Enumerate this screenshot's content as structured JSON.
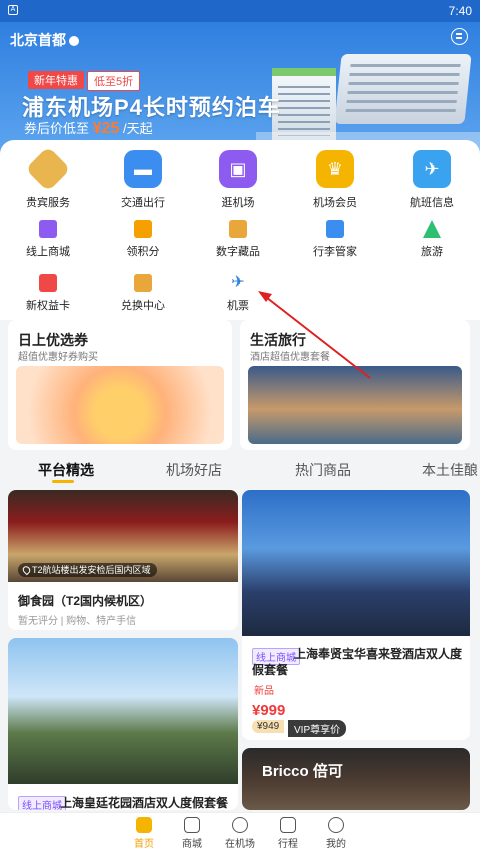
{
  "status": {
    "time": "7:40"
  },
  "header": {
    "city": "北京首都"
  },
  "hero": {
    "tag_new": "新年特惠",
    "tag_discount": "低至5折",
    "title": "浦东机场P4长时预约泊车",
    "sub_prefix": "券后价低至",
    "price": "¥25",
    "sub_suffix": "/天起"
  },
  "services_main": [
    {
      "label": "贵宾服务",
      "icon": "diamond-icon",
      "color": "#e9b54e"
    },
    {
      "label": "交通出行",
      "icon": "car-icon",
      "color": "#3b8df0"
    },
    {
      "label": "逛机场",
      "icon": "shop-icon",
      "color": "#8e5bf0"
    },
    {
      "label": "机场会员",
      "icon": "crown-icon",
      "color": "#f5b400"
    },
    {
      "label": "航班信息",
      "icon": "flight-board-icon",
      "color": "#3aa3f0"
    }
  ],
  "services_sub": [
    {
      "label": "线上商城",
      "icon": "bag-icon",
      "color": "#8e5bf0"
    },
    {
      "label": "领积分",
      "icon": "points-icon",
      "color": "#f5a000"
    },
    {
      "label": "数字藏品",
      "icon": "cube-icon",
      "color": "#e9a63a"
    },
    {
      "label": "行李管家",
      "icon": "luggage-icon",
      "color": "#3b8df0"
    },
    {
      "label": "旅游",
      "icon": "mountain-icon",
      "color": "#2fbf71"
    },
    {
      "label": "新权益卡",
      "icon": "card-icon",
      "color": "#f04747"
    },
    {
      "label": "兑换中心",
      "icon": "exchange-icon",
      "color": "#e9a63a"
    },
    {
      "label": "机票",
      "icon": "plane-icon",
      "color": "#2f7fe0"
    }
  ],
  "promos": [
    {
      "title": "日上优选券",
      "subtitle": "超值优惠好券购买"
    },
    {
      "title": "生活旅行",
      "subtitle": "酒店超值优惠套餐"
    }
  ],
  "tabs": [
    "平台精选",
    "机场好店",
    "热门商品",
    "本土佳酿"
  ],
  "products": {
    "p1": {
      "location": "T2航站楼出发安检后国内区域",
      "title": "御食园（T2国内候机区）",
      "sub": "暂无评分 | 购物、特产手信"
    },
    "p2": {
      "badge": "线上商城",
      "title": "上海奉贤宝华喜来登酒店双人度假套餐",
      "tag": "新品",
      "price": "¥999",
      "old_price": "¥949",
      "vip": "VIP尊享价"
    },
    "p3": {
      "badge": "线上商城",
      "title": "上海皇廷花园酒店双人度假套餐"
    },
    "p4": {
      "sign": "Bricco 倍可"
    }
  },
  "nav": [
    {
      "label": "首页",
      "icon": "home-icon",
      "active": true
    },
    {
      "label": "商城",
      "icon": "bag-icon"
    },
    {
      "label": "在机场",
      "icon": "location-icon"
    },
    {
      "label": "行程",
      "icon": "calendar-icon"
    },
    {
      "label": "我的",
      "icon": "profile-icon"
    }
  ],
  "colors": {
    "brand_blue": "#2f7fe0",
    "accent_yellow": "#f5b400",
    "price_red": "#f03a3a",
    "annotation_red": "#e02020"
  }
}
